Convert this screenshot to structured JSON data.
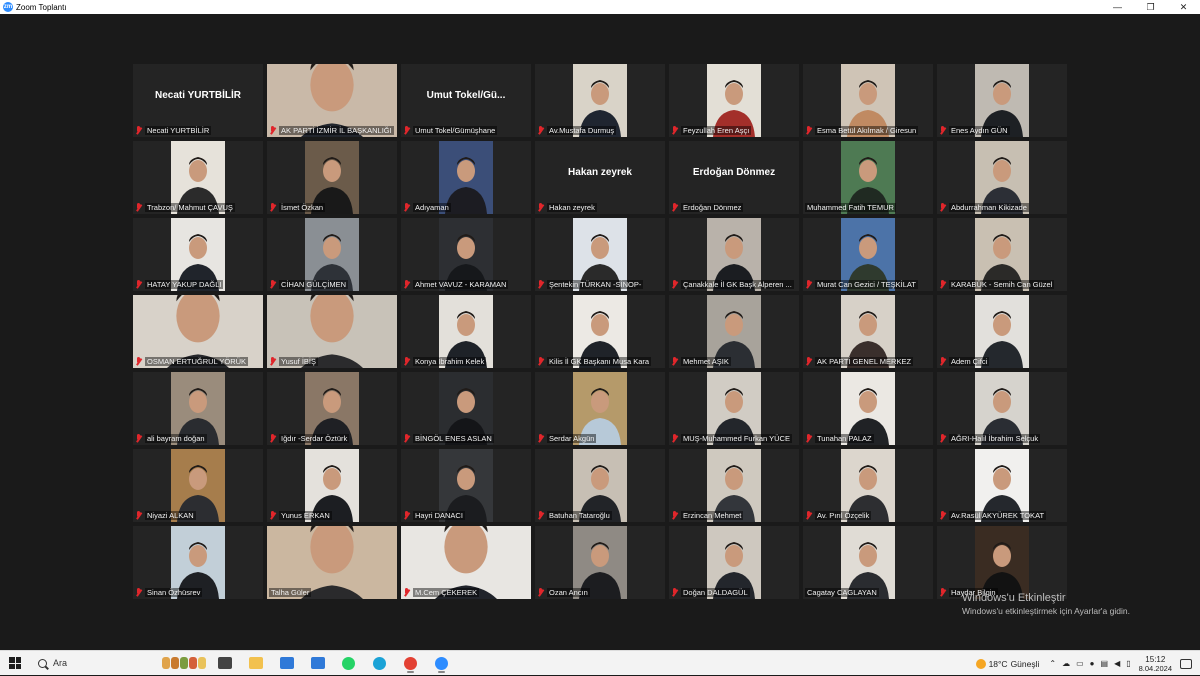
{
  "window": {
    "title": "Zoom Toplantı",
    "app_icon": "zm"
  },
  "window_controls": [
    "—",
    "❐",
    "✕"
  ],
  "participants": [
    {
      "name": "Necati YURTBİLİR",
      "display": "Necati YURTBİLİR",
      "video": false,
      "muted": true
    },
    {
      "name": "AK PARTİ İZMİR İL BAŞKANLIĞI",
      "video": true,
      "active": true,
      "muted": true,
      "bg": "#c9b9a8",
      "shirt": "#22262e"
    },
    {
      "name": "Umut Tokel/Gümüşhane",
      "display": "Umut  Tokel/Gü...",
      "video": false,
      "muted": true
    },
    {
      "name": "Av.Mustafa Durmuş",
      "video": true,
      "muted": true,
      "bg": "#d9d3c8",
      "shirt": "#1f2530"
    },
    {
      "name": "Feyzullah Eren Aşçı",
      "video": true,
      "muted": true,
      "bg": "#e3dfd6",
      "shirt": "#a32f2a"
    },
    {
      "name": "Esma Betül Akılmak / Giresun",
      "video": true,
      "muted": true,
      "bg": "#cfc4b6",
      "shirt": "#c08a62"
    },
    {
      "name": "Enes Aydın GÜN",
      "video": true,
      "muted": true,
      "bg": "#bfbab2",
      "shirt": "#1d2024"
    },
    {
      "name": "Trabzon/ Mahmut ÇAVUŞ",
      "video": true,
      "muted": true,
      "bg": "#e6e2da",
      "shirt": "#2b2b2b"
    },
    {
      "name": "İsmet Özkan",
      "video": true,
      "muted": true,
      "bg": "#6b5b4a",
      "shirt": "#191919"
    },
    {
      "name": "Adıyaman",
      "video": true,
      "muted": true,
      "bg": "#3b4e78",
      "shirt": "#1c1c22"
    },
    {
      "name": "Hakan zeyrek",
      "display": "Hakan zeyrek",
      "video": false,
      "muted": true
    },
    {
      "name": "Erdoğan Dönmez",
      "display": "Erdoğan Dönmez",
      "video": false,
      "muted": true
    },
    {
      "name": "Muhammed Fatih TEMUR",
      "video": true,
      "muted": false,
      "bg": "#4e7a53",
      "shirt": "#202a22"
    },
    {
      "name": "Abdurrahman Kikizade",
      "video": true,
      "muted": true,
      "bg": "#c7bfb2",
      "shirt": "#2c2f36"
    },
    {
      "name": "HATAY YAKUP DAĞLI",
      "video": true,
      "muted": true,
      "bg": "#e7e5e1",
      "shirt": "#20242b"
    },
    {
      "name": "CİHAN GÜLÇİMEN",
      "video": true,
      "muted": true,
      "bg": "#8a8f94",
      "shirt": "#2e3238"
    },
    {
      "name": "Ahmet VAVUZ - KARAMAN",
      "video": true,
      "muted": true,
      "bg": "#2d2f33",
      "shirt": "#16181b"
    },
    {
      "name": "Şentekin TÜRKAN  -SİNOP-",
      "video": true,
      "muted": true,
      "bg": "#dde2e8",
      "shirt": "#2a2a2a"
    },
    {
      "name": "Çanakkale İl GK Başk Alperen ...",
      "video": true,
      "muted": true,
      "bg": "#b9b2aa",
      "shirt": "#1b1d21"
    },
    {
      "name": "Murat Can Gezici / TEŞKİLAT",
      "video": true,
      "muted": true,
      "bg": "#4c73a8",
      "shirt": "#2f3a2e"
    },
    {
      "name": "KARABÜK - Semih Can Güzel",
      "video": true,
      "muted": true,
      "bg": "#c9c0b2",
      "shirt": "#2b2a28"
    },
    {
      "name": "OSMAN ERTUĞRUL YÖRÜK",
      "video": true,
      "muted": true,
      "bg": "#d8d2c9",
      "shirt": "#26272b"
    },
    {
      "name": "Yusuf İBİŞ",
      "video": true,
      "muted": true,
      "bg": "#c8c2b8",
      "shirt": "#2b2b2d"
    },
    {
      "name": "Konya İbrahim Kelek",
      "video": true,
      "muted": true,
      "bg": "#e3e0da",
      "shirt": "#1e2228"
    },
    {
      "name": "Kilis İl GK Başkanı Musa Kara",
      "video": true,
      "muted": true,
      "bg": "#ece9e4",
      "shirt": "#1f2329"
    },
    {
      "name": "Mehmet AŞIK",
      "video": true,
      "muted": true,
      "bg": "#a8a39b",
      "shirt": "#2b2e33"
    },
    {
      "name": "AK PARTİ GENEL MERKEZ",
      "video": true,
      "muted": true,
      "bg": "#d7d1c8",
      "shirt": "#3a2f2c"
    },
    {
      "name": "Adem Çifci",
      "video": true,
      "muted": true,
      "bg": "#e2e0dc",
      "shirt": "#24282d"
    },
    {
      "name": "ali bayram doğan",
      "video": true,
      "muted": true,
      "bg": "#9a8c7c",
      "shirt": "#2a2c30"
    },
    {
      "name": "Iğdır -Serdar Öztürk",
      "video": true,
      "muted": true,
      "bg": "#8a7766",
      "shirt": "#1f2024"
    },
    {
      "name": "BİNGÖL ENES ASLAN",
      "video": true,
      "muted": true,
      "bg": "#2b2d30",
      "shirt": "#141518"
    },
    {
      "name": "Serdar Akgün",
      "video": true,
      "muted": true,
      "bg": "#b59a6a",
      "shirt": "#b7c9d8"
    },
    {
      "name": "MUŞ-Muhammed Furkan YÜCE",
      "video": true,
      "muted": true,
      "bg": "#d1ccc4",
      "shirt": "#23262b"
    },
    {
      "name": "Tunahan PALAZ",
      "video": true,
      "muted": true,
      "bg": "#ebe8e3",
      "shirt": "#202225"
    },
    {
      "name": "AĞRI-Halil İbrahim Selçuk",
      "video": true,
      "muted": true,
      "bg": "#d6d3cd",
      "shirt": "#2a2d33"
    },
    {
      "name": "Niyazi ALKAN",
      "video": true,
      "muted": true,
      "bg": "#a67d4c",
      "shirt": "#2c2d31"
    },
    {
      "name": "Yunus ERKAN",
      "video": true,
      "muted": true,
      "bg": "#e4e1dc",
      "shirt": "#1c1e22"
    },
    {
      "name": "Hayri DANACI",
      "video": true,
      "muted": true,
      "bg": "#35373a",
      "shirt": "#1b1c1f"
    },
    {
      "name": "Batuhan Tataroğlu",
      "video": true,
      "muted": true,
      "bg": "#c7bfb4",
      "shirt": "#222428"
    },
    {
      "name": "Erzincan Mehmet",
      "video": true,
      "muted": true,
      "bg": "#cfc9bf",
      "shirt": "#33363b"
    },
    {
      "name": "Av. Pırıl Özçelik",
      "video": true,
      "muted": true,
      "bg": "#dcd6cd",
      "shirt": "#2d2e31"
    },
    {
      "name": "Av.Rasül AKYÜREK TOKAT",
      "video": true,
      "muted": true,
      "bg": "#f1f0ee",
      "shirt": "#25282d"
    },
    {
      "name": "Sinan Özhüsrev",
      "video": true,
      "muted": true,
      "bg": "#c2cfd8",
      "shirt": "#1e2024"
    },
    {
      "name": "Talha Güler",
      "video": true,
      "muted": false,
      "bg": "#cbb7a0",
      "shirt": "#2a2a2c"
    },
    {
      "name": "M.Cem ÇEKEREK",
      "video": true,
      "muted": true,
      "bg": "#e8e6e2",
      "shirt": "#20232a"
    },
    {
      "name": "Ozan Ancın",
      "video": true,
      "muted": true,
      "bg": "#8f8a84",
      "shirt": "#1c1d20"
    },
    {
      "name": "Doğan DALDAGÜL",
      "video": true,
      "muted": true,
      "bg": "#cec8bf",
      "shirt": "#23262c"
    },
    {
      "name": "Cagatay CAGLAYAN",
      "video": true,
      "muted": false,
      "bg": "#e0dcd5",
      "shirt": "#2a2c30"
    },
    {
      "name": "Haydar Bilgin",
      "video": true,
      "muted": true,
      "bg": "#3a2c22",
      "shirt": "#121212"
    }
  ],
  "watermark": {
    "line1": "Windows'u Etkinleştir",
    "line2": "Windows'u etkinleştirmek için Ayarlar'a gidin."
  },
  "taskbar": {
    "search_placeholder": "Ara",
    "apps": [
      {
        "icon": "task-view-icon",
        "color": "#444444",
        "running": false
      },
      {
        "icon": "file-explorer-icon",
        "color": "#f2c14e",
        "running": false
      },
      {
        "icon": "store-icon",
        "color": "#2f79d8",
        "running": false
      },
      {
        "icon": "mail-icon",
        "color": "#2f79d8",
        "running": false
      },
      {
        "icon": "whatsapp-icon",
        "color": "#25d366",
        "running": false
      },
      {
        "icon": "edge-icon",
        "color": "#1aa2d6",
        "running": false
      },
      {
        "icon": "chrome-icon",
        "color": "#e34133",
        "running": true
      },
      {
        "icon": "zoom-icon",
        "color": "#2d8cff",
        "running": true
      }
    ],
    "weather_temp": "18°C",
    "weather_text": "Güneşli",
    "time": "15:12",
    "date": "8.04.2024"
  }
}
